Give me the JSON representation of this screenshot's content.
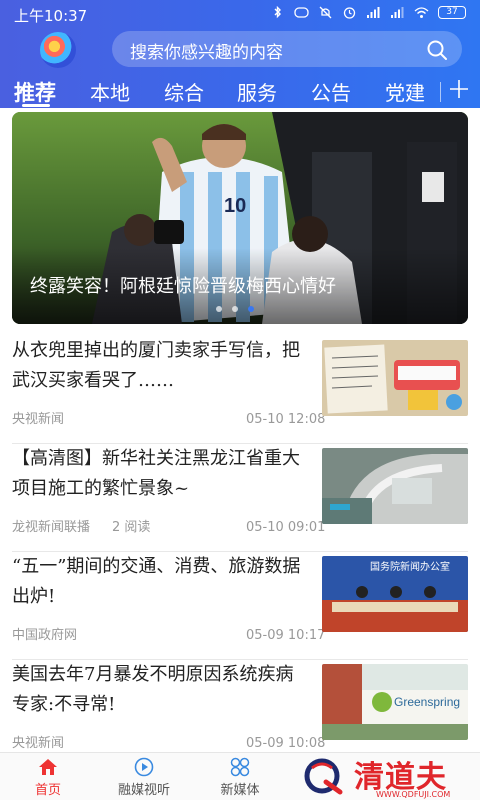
{
  "status_bar": {
    "time": "上午10:37",
    "battery": "37"
  },
  "search": {
    "placeholder": "搜索你感兴趣的内容"
  },
  "tabs": [
    {
      "label": "推荐",
      "active": true
    },
    {
      "label": "本地"
    },
    {
      "label": "综合"
    },
    {
      "label": "服务"
    },
    {
      "label": "公告"
    },
    {
      "label": "党建"
    }
  ],
  "banner": {
    "caption": "终露笑容！阿根廷惊险晋级梅西心情好",
    "slide_count": 3,
    "active_slide": 3
  },
  "news": [
    {
      "title": "从衣兜里掉出的厦门卖家手写信，把武汉买家看哭了……",
      "source": "央视新闻",
      "reads": "",
      "time": "05-10 12:08",
      "thumb": "handwritten-letter-and-toys"
    },
    {
      "title": "【高清图】新华社关注黑龙江省重大项目施工的繁忙景象~",
      "source": "龙视新闻联播",
      "reads": "2 阅读",
      "time": "05-10 09:01",
      "thumb": "construction-site-aerial"
    },
    {
      "title": "“五一”期间的交通、消费、旅游数据出炉!",
      "source": "中国政府网",
      "reads": "",
      "time": "05-09 10:17",
      "thumb": "press-conference-hall"
    },
    {
      "title": "美国去年7月暴发不明原因系统疾病 专家:不寻常!",
      "source": "央视新闻",
      "reads": "",
      "time": "05-09 10:08",
      "thumb": "greenspring-building"
    }
  ],
  "thumb_texts": {
    "press_banner": "国务院新闻办公室",
    "greenspring": "Greenspring"
  },
  "bottom_nav": [
    {
      "label": "首页",
      "icon": "home-icon",
      "active": true
    },
    {
      "label": "融媒视听",
      "icon": "play-circle-icon"
    },
    {
      "label": "新媒体",
      "icon": "grid-icon"
    }
  ],
  "watermark": {
    "text": "清道夫",
    "url": "WWW.QDFUJI.COM"
  },
  "colors": {
    "header_start": "#4a60e0",
    "header_end": "#2f76f2",
    "active_nav": "#ee3333",
    "watermark": "#e0262b"
  }
}
